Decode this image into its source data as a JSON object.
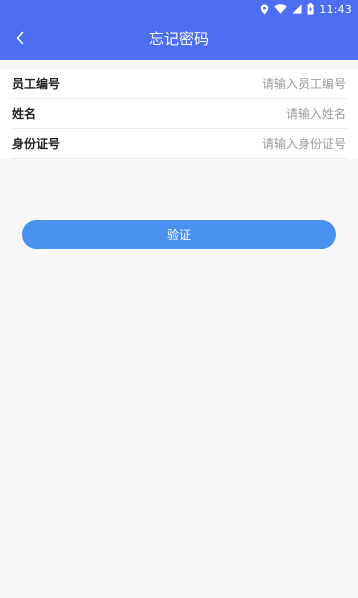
{
  "status_bar": {
    "time": "11:43",
    "icons": [
      "location-icon",
      "wifi-icon",
      "signal-icon",
      "battery-icon"
    ]
  },
  "header": {
    "title": "忘记密码",
    "back_icon": "chevron-left-icon"
  },
  "form": {
    "fields": [
      {
        "label": "员工编号",
        "placeholder": "请输入员工编号",
        "value": ""
      },
      {
        "label": "姓名",
        "placeholder": "请输入姓名",
        "value": ""
      },
      {
        "label": "身份证号",
        "placeholder": "请输入身份证号",
        "value": ""
      }
    ]
  },
  "actions": {
    "verify_label": "验证"
  },
  "colors": {
    "primary": "#4d6ef0",
    "button": "#4891ef",
    "background": "#f7f7f9",
    "divider": "#ececf0"
  }
}
